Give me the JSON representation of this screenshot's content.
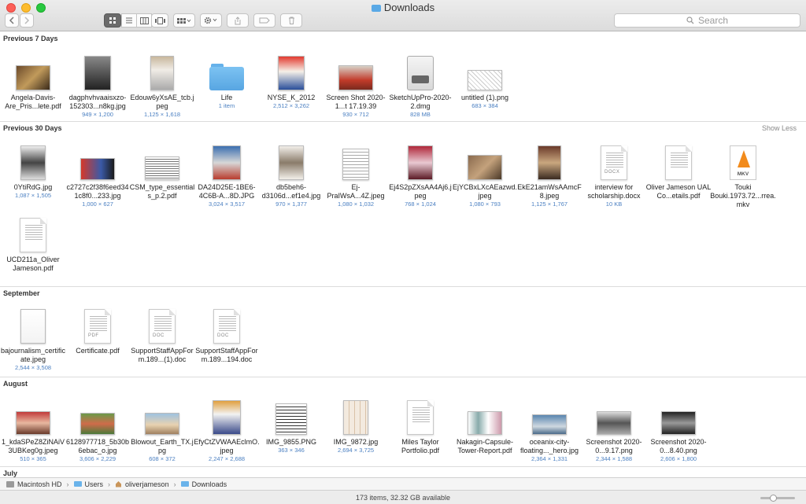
{
  "window": {
    "title": "Downloads"
  },
  "toolbar": {
    "search_placeholder": "Search"
  },
  "sections": [
    {
      "label": "Previous 7 Days"
    },
    {
      "label": "Previous 30 Days",
      "action": "Show Less"
    },
    {
      "label": "September"
    },
    {
      "label": "August"
    },
    {
      "label": "July"
    }
  ],
  "files7": [
    {
      "name": "Angela-Davis-Are_Pris...lete.pdf",
      "meta": ""
    },
    {
      "name": "dagphvhvaaisxzo-152303...n8kg.jpg",
      "meta": "949 × 1,200"
    },
    {
      "name": "Edouw6yXsAE_tcb.jpeg",
      "meta": "1,125 × 1,618"
    },
    {
      "name": "Life",
      "meta": "1 item"
    },
    {
      "name": "NYSE_K_2012",
      "meta": "2,512 × 3,262"
    },
    {
      "name": "Screen Shot 2020-1...t 17.19.39",
      "meta": "930 × 712"
    },
    {
      "name": "SketchUpPro-2020-2.dmg",
      "meta": "828 MB"
    },
    {
      "name": "untitled (1).png",
      "meta": "683 × 384"
    }
  ],
  "files30": [
    {
      "name": "0YtiRdG.jpg",
      "meta": "1,087 × 1,505"
    },
    {
      "name": "c2727c2f38f6eed341c8f0...233.jpg",
      "meta": "1,000 × 627"
    },
    {
      "name": "CSM_type_essentials_p.2.pdf",
      "meta": ""
    },
    {
      "name": "DA24D25E-1BE6-4C6B-A...8D.JPG",
      "meta": "3,024 × 3,517"
    },
    {
      "name": "db5beh6-d3106d...ef1e4.jpg",
      "meta": "970 × 1,377"
    },
    {
      "name": "Ej-PraIWsA...4Z.jpeg",
      "meta": "1,080 × 1,032"
    },
    {
      "name": "Ej4S2pZXsAA4Aj6.jpeg",
      "meta": "768 × 1,024"
    },
    {
      "name": "EjYCBxLXcAEazwd.jpeg",
      "meta": "1,080 × 793"
    },
    {
      "name": "EkE21amWsAAmcF8.jpeg",
      "meta": "1,125 × 1,767"
    },
    {
      "name": "interview for scholarship.docx",
      "meta": "10 KB"
    },
    {
      "name": "Oliver Jameson UAL Co...etails.pdf",
      "meta": ""
    },
    {
      "name": "Touki Bouki.1973.72...rrea.mkv",
      "meta": ""
    },
    {
      "name": "UCD211a_Oliver Jameson.pdf",
      "meta": ""
    }
  ],
  "filesSep": [
    {
      "name": "bajournalism_certificate.jpeg",
      "meta": "2,544 × 3,508"
    },
    {
      "name": "Certificate.pdf",
      "meta": ""
    },
    {
      "name": "SupportStaffAppForm.189...(1).doc",
      "meta": ""
    },
    {
      "name": "SupportStaffAppForm.189...194.doc",
      "meta": ""
    }
  ],
  "filesAug": [
    {
      "name": "1_kdaSPeZ8ZiNAiV3UBKeg0g.jpeg",
      "meta": "510 × 365"
    },
    {
      "name": "6128977718_5b30b6ebac_o.jpg",
      "meta": "3,606 × 2,229"
    },
    {
      "name": "Blowout_Earth_TX.jpg",
      "meta": "608 × 372"
    },
    {
      "name": "EfyCtZVWAAEclmO.jpeg",
      "meta": "2,247 × 2,688"
    },
    {
      "name": "IMG_9855.PNG",
      "meta": "363 × 346"
    },
    {
      "name": "IMG_9872.jpg",
      "meta": "2,694 × 3,725"
    },
    {
      "name": "Miles Taylor Portfolio.pdf",
      "meta": ""
    },
    {
      "name": "Nakagin-Capsule-Tower-Report.pdf",
      "meta": ""
    },
    {
      "name": "oceanix-city-floating..._hero.jpg",
      "meta": "2,364 × 1,331"
    },
    {
      "name": "Screenshot 2020-0...9.17.png",
      "meta": "2,344 × 1,588"
    },
    {
      "name": "Screenshot 2020-0...8.40.png",
      "meta": "2,606 × 1,800"
    }
  ],
  "doc_tags": {
    "docx": "DOCX",
    "pdf": "PDF",
    "doc": "DOC",
    "mkv": "MKV"
  },
  "pathbar": {
    "disk": "Macintosh HD",
    "users": "Users",
    "user": "oliverjameson",
    "folder": "Downloads"
  },
  "status": {
    "text": "173 items, 32.32 GB available"
  },
  "colors": {
    "accent": "#4a7fc1",
    "folder": "#5aa9e6",
    "close": "#fc5f57",
    "minimize": "#fdbc2e",
    "zoom": "#28c840"
  },
  "icons": [
    "back-icon",
    "forward-icon",
    "icon-view-icon",
    "list-view-icon",
    "column-view-icon",
    "gallery-view-icon",
    "group-icon",
    "gear-icon",
    "share-icon",
    "tag-icon",
    "trash-icon",
    "search-icon"
  ]
}
